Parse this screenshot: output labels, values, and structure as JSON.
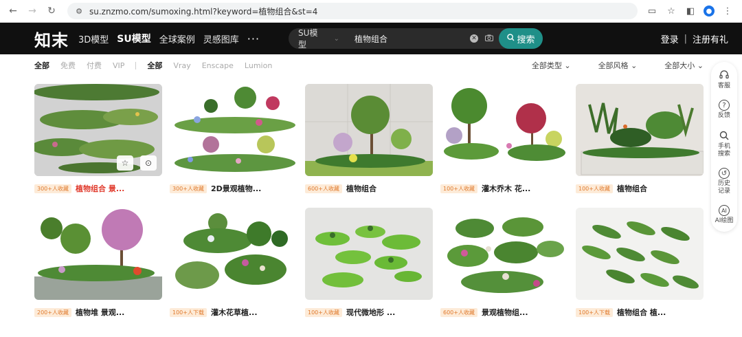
{
  "browser": {
    "url": "su.znzmo.com/sumoxing.html?keyword=植物组合&st=4"
  },
  "header": {
    "logo": "知末",
    "nav": [
      {
        "label": "3D模型",
        "active": false
      },
      {
        "label": "SU模型",
        "active": true
      },
      {
        "label": "全球案例",
        "active": false
      },
      {
        "label": "灵感图库",
        "active": false
      }
    ],
    "more": "···",
    "search": {
      "category": "SU模型",
      "query": "植物组合",
      "button": "搜索"
    },
    "login": "登录",
    "separator": "|",
    "register": "注册有礼"
  },
  "filters": {
    "price": [
      {
        "label": "全部",
        "active": true
      },
      {
        "label": "免费",
        "active": false
      },
      {
        "label": "付费",
        "active": false
      },
      {
        "label": "VIP",
        "active": false
      }
    ],
    "renderer": [
      {
        "label": "全部",
        "active": true
      },
      {
        "label": "Vray",
        "active": false
      },
      {
        "label": "Enscape",
        "active": false
      },
      {
        "label": "Lumion",
        "active": false
      }
    ],
    "dropdowns": [
      "全部类型",
      "全部风格",
      "全部大小"
    ]
  },
  "cards": [
    {
      "badge": "300+人收藏",
      "title": "植物组合 景...",
      "highlight": true,
      "scene": "rows"
    },
    {
      "badge": "300+人收藏",
      "title": "2D景观植物...",
      "highlight": false,
      "scene": "garden"
    },
    {
      "badge": "600+人收藏",
      "title": "植物组合",
      "highlight": false,
      "scene": "wall"
    },
    {
      "badge": "100+人收藏",
      "title": "灌木乔木 花...",
      "highlight": false,
      "scene": "trees"
    },
    {
      "badge": "100+人收藏",
      "title": "植物组合",
      "highlight": false,
      "scene": "planter"
    },
    {
      "badge": "200+人收藏",
      "title": "植物堆 景观...",
      "highlight": false,
      "scene": "blossom"
    },
    {
      "badge": "100+人下载",
      "title": "灌木花草植...",
      "highlight": false,
      "scene": "shrubs"
    },
    {
      "badge": "100+人收藏",
      "title": "现代微地形 ...",
      "highlight": false,
      "scene": "mounds"
    },
    {
      "badge": "600+人收藏",
      "title": "景观植物组...",
      "highlight": false,
      "scene": "cluster"
    },
    {
      "badge": "100+人下载",
      "title": "植物组合 植...",
      "highlight": false,
      "scene": "beds"
    }
  ],
  "sidebar": [
    {
      "label": "客服",
      "icon": "headset-icon"
    },
    {
      "label": "反馈",
      "icon": "help-icon"
    },
    {
      "label": "手机搜索",
      "icon": "search-icon"
    },
    {
      "label": "历史记录",
      "icon": "history-icon"
    },
    {
      "label": "AI绘图",
      "icon": "ai-icon"
    }
  ],
  "colors": {
    "header_bg": "#101010",
    "accent": "#1f8f88",
    "badge_bg": "#fdebd8",
    "badge_text": "#e07a2d",
    "highlight": "#e0392b"
  }
}
